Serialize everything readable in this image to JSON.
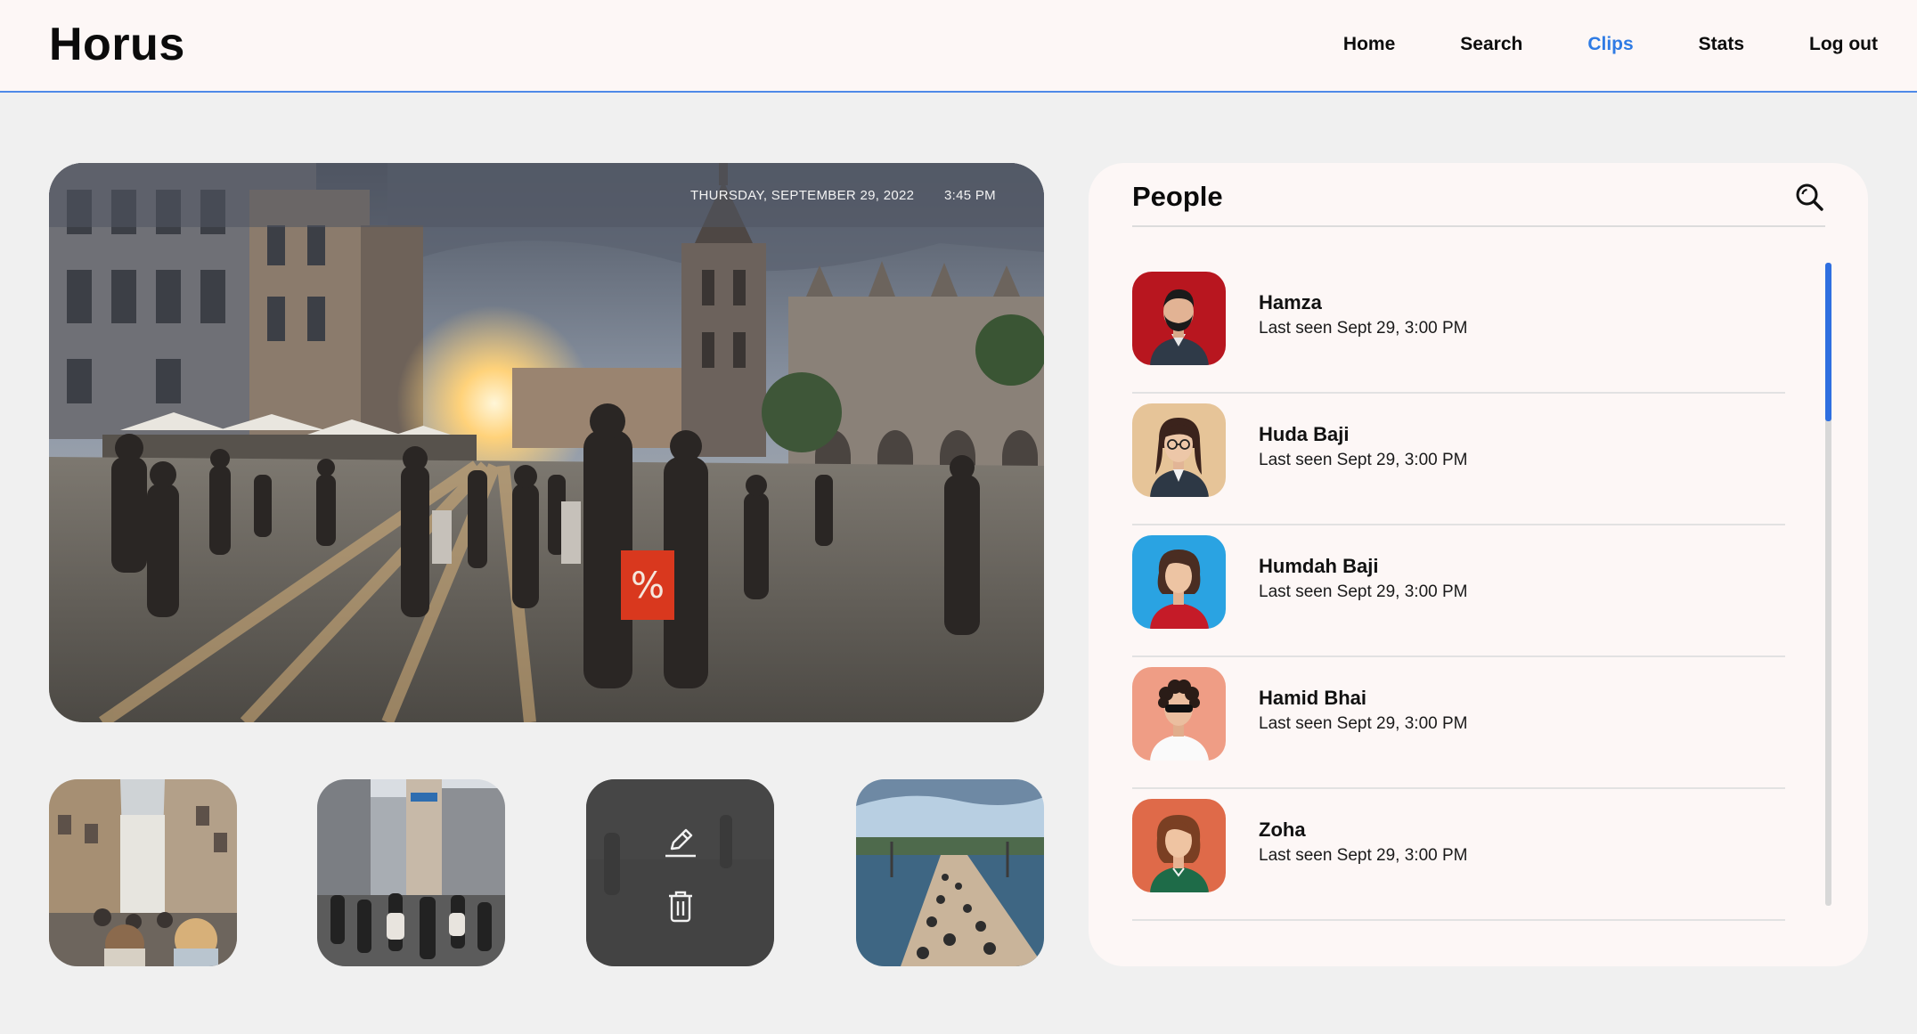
{
  "app": {
    "title": "Horus"
  },
  "nav": {
    "items": [
      {
        "label": "Home",
        "active": false
      },
      {
        "label": "Search",
        "active": false
      },
      {
        "label": "Clips",
        "active": true
      },
      {
        "label": "Stats",
        "active": false
      },
      {
        "label": "Log out",
        "active": false
      }
    ]
  },
  "hero": {
    "date": "THURSDAY, SEPTEMBER 29, 2022",
    "time": "3:45 PM"
  },
  "thumbnails": {
    "actions": {
      "edit_icon": "pencil-icon",
      "delete_icon": "trash-icon"
    }
  },
  "people": {
    "title": "People",
    "search_icon": "search-icon",
    "list": [
      {
        "name": "Hamza",
        "seen": "Last seen Sept 29, 3:00 PM",
        "color": "#b8161f"
      },
      {
        "name": "Huda Baji",
        "seen": "Last seen Sept 29, 3:00 PM",
        "color": "#e6c498"
      },
      {
        "name": "Humdah Baji",
        "seen": "Last seen Sept 29, 3:00 PM",
        "color": "#2aa3e2"
      },
      {
        "name": "Hamid Bhai",
        "seen": "Last seen Sept 29, 3:00 PM",
        "color": "#ef9d85"
      },
      {
        "name": "Zoha",
        "seen": "Last seen Sept 29, 3:00 PM",
        "color": "#df6a49"
      }
    ]
  },
  "colors": {
    "accent": "#2f7be4",
    "scrollbar": "#2f6fe0",
    "panel": "#fdf7f6",
    "background": "#f0f0f0"
  }
}
